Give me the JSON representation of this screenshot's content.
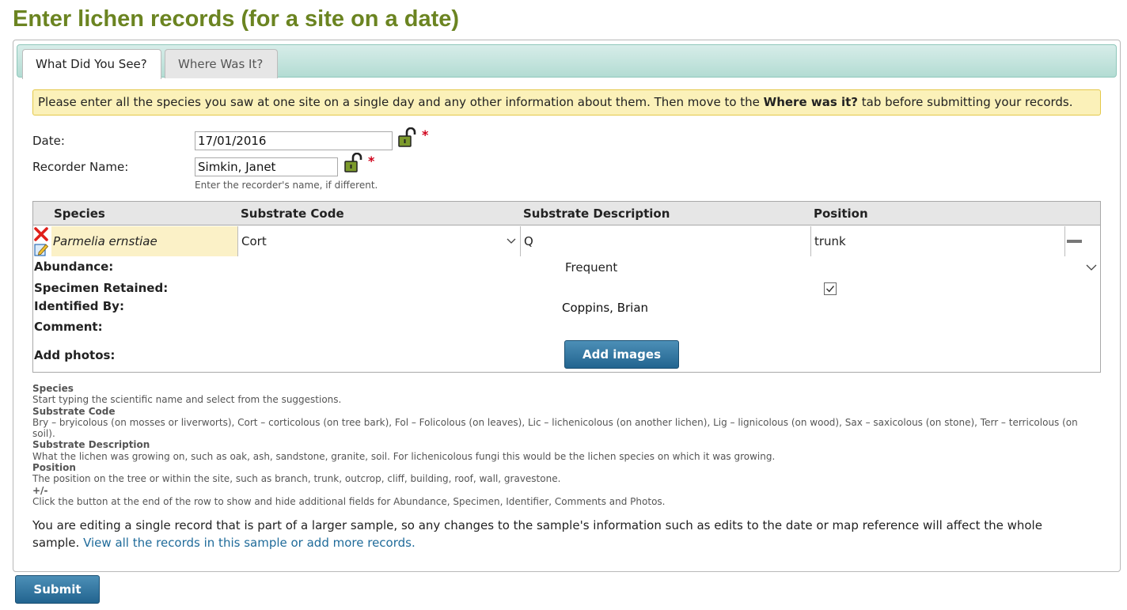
{
  "page_title": "Enter lichen records (for a site on a date)",
  "tabs": [
    {
      "label": "What Did You See?",
      "active": true
    },
    {
      "label": "Where Was It?",
      "active": false
    }
  ],
  "banner": {
    "text_before": "Please enter all the species you saw at one site on a single day and any other information about them. Then move to the ",
    "bold": "Where was it?",
    "text_after": " tab before submitting your records."
  },
  "date": {
    "label": "Date:",
    "value": "17/01/2016",
    "required_mark": "*",
    "lock_icon": "padlock-unlocked-icon"
  },
  "recorder": {
    "label": "Recorder Name:",
    "value": "Simkin, Janet",
    "required_mark": "*",
    "help": "Enter the recorder's name, if different.",
    "lock_icon": "padlock-unlocked-icon"
  },
  "grid": {
    "columns": [
      "Species",
      "Substrate Code",
      "Substrate Description",
      "Position"
    ],
    "row": {
      "species": "Parmelia ernstiae",
      "substrate_code": "Cort",
      "substrate_description": "Q",
      "position": "trunk",
      "delete_icon": "delete-x-icon",
      "edit_icon": "edit-pencil-icon",
      "collapse_icon": "minus-icon"
    },
    "details": {
      "abundance_label": "Abundance:",
      "abundance_value": "Frequent",
      "specimen_label": "Specimen Retained:",
      "specimen_checked": true,
      "identified_label": "Identified By:",
      "identified_value": "Coppins, Brian",
      "comment_label": "Comment:",
      "photos_label": "Add photos:",
      "add_images_button": "Add images"
    }
  },
  "guide": [
    {
      "heading": "Species",
      "text": "Start typing the scientific name and select from the suggestions."
    },
    {
      "heading": "Substrate Code",
      "text": "Bry – bryicolous (on mosses or liverworts), Cort – corticolous (on tree bark), Fol – Folicolous (on leaves), Lic – lichenicolous (on another lichen), Lig – lignicolous (on wood), Sax – saxicolous (on stone), Terr – terricolous (on soil)."
    },
    {
      "heading": "Substrate Description",
      "text": "What the lichen was growing on, such as oak, ash, sandstone, granite, soil. For lichenicolous fungi this would be the lichen species on which it was growing."
    },
    {
      "heading": "Position",
      "text": "The position on the tree or within the site, such as branch, trunk, outcrop, cliff, building, roof, wall, gravestone."
    },
    {
      "heading": "+/-",
      "text": "Click the button at the end of the row to show and hide additional fields for Abundance, Specimen, Identifier, Comments and Photos."
    }
  ],
  "note": {
    "text": "You are editing a single record that is part of a larger sample, so any changes to the sample's information such as edits to the date or map reference will affect the whole sample. ",
    "link": "View all the records in this sample or add more records."
  },
  "submit_label": "Submit",
  "colors": {
    "title": "#6b8421",
    "button": "#2a6f9b",
    "banner": "#fbf1b9",
    "tabbar": "#b3dcd3",
    "required": "#d0021b",
    "link": "#1f6b9a"
  }
}
